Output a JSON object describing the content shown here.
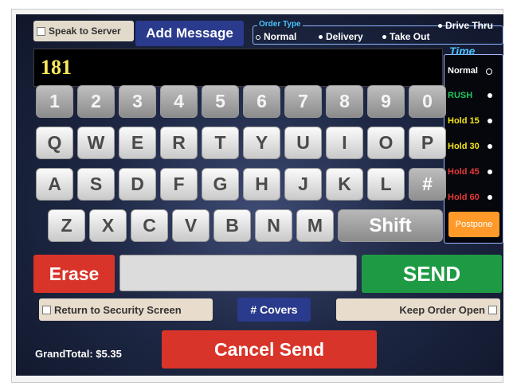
{
  "speak_to_server": {
    "label": "Speak to Server"
  },
  "add_message": {
    "label": "Add Message"
  },
  "order_type": {
    "label": "Order Type",
    "options": [
      {
        "label": "Normal",
        "selected": true
      },
      {
        "label": "Delivery",
        "selected": false
      },
      {
        "label": "Take Out",
        "selected": false
      },
      {
        "label": "Drive Thru",
        "selected": false
      }
    ]
  },
  "display": {
    "value": "181"
  },
  "time": {
    "label": "Time",
    "options": [
      {
        "label": "Normal",
        "color": "#ffffff"
      },
      {
        "label": "RUSH",
        "color": "#22c55e"
      },
      {
        "label": "Hold 15",
        "color": "#f4e21b"
      },
      {
        "label": "Hold 30",
        "color": "#f4e21b"
      },
      {
        "label": "Hold 45",
        "color": "#e53935"
      },
      {
        "label": "Hold 60",
        "color": "#e53935"
      }
    ],
    "postpone_label": "Postpone"
  },
  "keyboard": {
    "rows": [
      [
        "1",
        "2",
        "3",
        "4",
        "5",
        "6",
        "7",
        "8",
        "9",
        "0"
      ],
      [
        "Q",
        "W",
        "E",
        "R",
        "T",
        "Y",
        "U",
        "I",
        "O",
        "P"
      ],
      [
        "A",
        "S",
        "D",
        "F",
        "G",
        "H",
        "J",
        "K",
        "L",
        "#"
      ],
      [
        "Z",
        "X",
        "C",
        "V",
        "B",
        "N",
        "M",
        "Shift"
      ]
    ]
  },
  "actions": {
    "erase_label": "Erase",
    "send_label": "SEND",
    "return_security_label": "Return to Security Screen",
    "covers_label": "# Covers",
    "keep_open_label": "Keep Order Open",
    "cancel_send_label": "Cancel Send"
  },
  "grand_total": {
    "text": "GrandTotal: $5.35"
  },
  "colors": {
    "accent_blue": "#2a3a8c",
    "erase_red": "#d9342a",
    "send_green": "#1f9a44",
    "postpone_orange": "#ff9a2a"
  }
}
